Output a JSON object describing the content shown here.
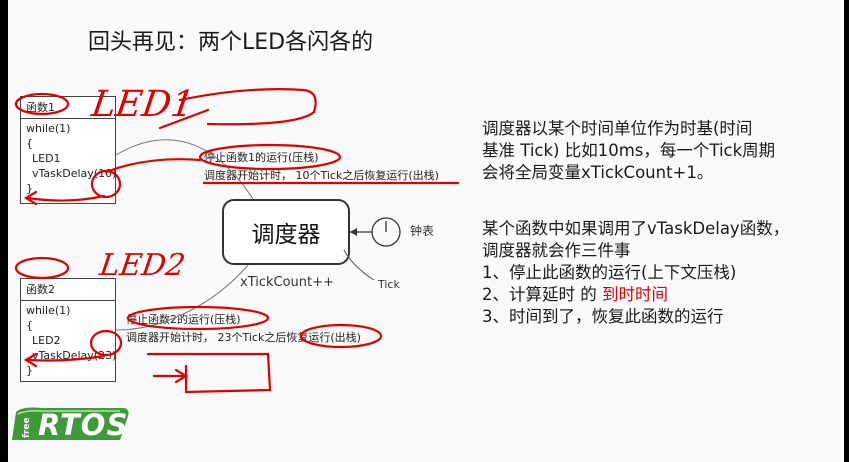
{
  "title": "回头再见：两个LED各闪各的",
  "func1": {
    "header": "函数1",
    "lines": [
      "while(1)",
      "{",
      "  LED1",
      "  vTaskDelay(10)",
      "}"
    ]
  },
  "func2": {
    "header": "函数2",
    "lines": [
      "while(1)",
      "{",
      "  LED2",
      "  vTaskDelay(23)",
      "}"
    ]
  },
  "handwriting": {
    "led1": "LED1",
    "led2": "LED2"
  },
  "scheduler": {
    "label": "调度器",
    "tick_count": "xTickCount++",
    "clock_label": "钟表",
    "tick_label": "Tick"
  },
  "notes1": {
    "line1": "停止函数1的运行(压栈)",
    "line2": "调度器开始计时，  10个Tick之后恢复运行(出栈)"
  },
  "notes2": {
    "line1": "停止函数2的运行(压栈)",
    "line2": "调度器开始计时，  23个Tick之后恢复运行(出栈)"
  },
  "right_panel": {
    "para1": [
      "调度器以某个时间单位作为时基(时间",
      "基准  Tick) 比如10ms，每一个Tick周期",
      "会将全局变量xTickCount+1。"
    ],
    "para2_intro": [
      "某个函数中如果调用了vTaskDelay函数，",
      "调度器就会作三件事"
    ],
    "step1": "1、停止此函数的运行(上下文压栈)",
    "step2_prefix": "2、计算延时 的 ",
    "step2_highlight": "到时时间",
    "step3": "3、时间到了，恢复此函数的运行"
  },
  "logo": {
    "small": "free",
    "main": "RTOS"
  },
  "colors": {
    "annotation_red": "#e00000",
    "logo_green": "#3f9a3a",
    "background": "#fafafa"
  }
}
